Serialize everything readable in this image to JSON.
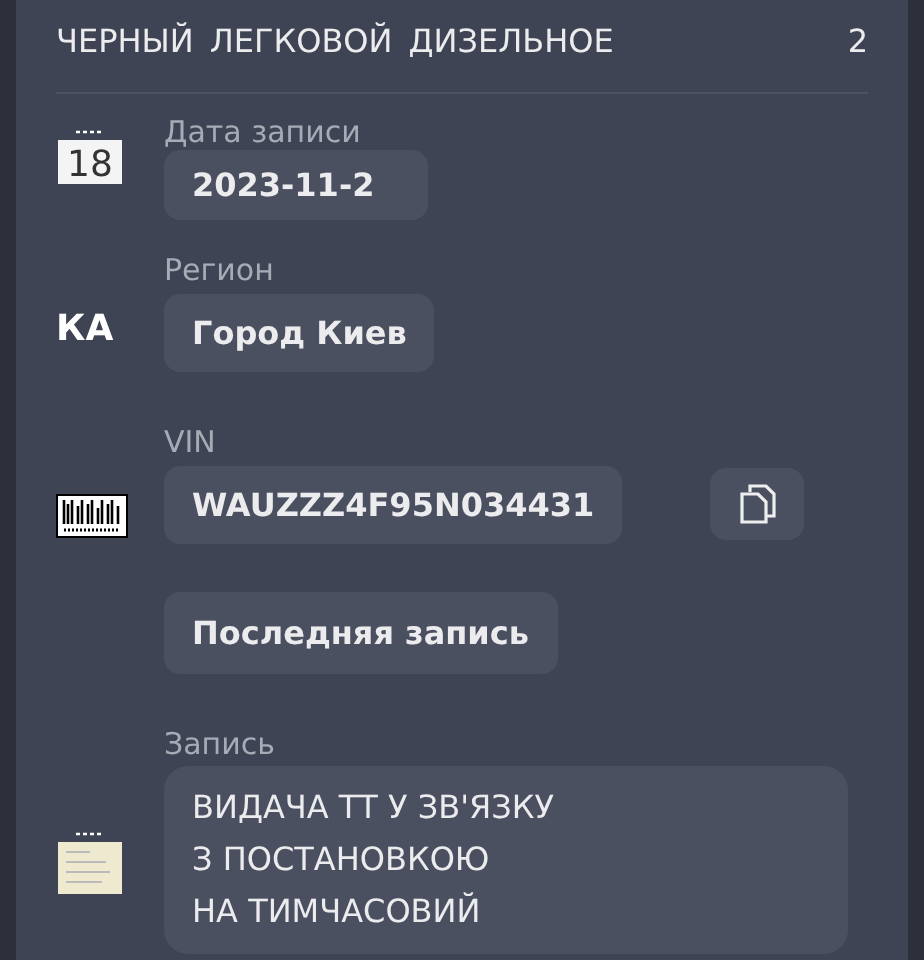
{
  "specs": {
    "values": [
      "ЧЕРНЫЙ",
      "ЛЕГКОВОЙ",
      "ДИЗЕЛЬНОЕ",
      "2"
    ]
  },
  "fields": [
    {
      "kind": "date",
      "icon_day": "18",
      "label": "Дата записи",
      "value": "2023-11-2"
    },
    {
      "kind": "region",
      "badge": "КА",
      "label": "Регион",
      "value": "Город Киев"
    },
    {
      "kind": "vin",
      "label": "VIN",
      "value": "WAUZZZ4F95N034431"
    },
    {
      "kind": "action",
      "button": "Последняя запись"
    },
    {
      "kind": "note",
      "label": "Запись",
      "lines": [
        "ВИДАЧА ТТ У ЗВ'ЯЗКУ",
        "З ПОСТАНОВКОЮ",
        "НА ТИМЧАСОВИЙ"
      ]
    }
  ]
}
